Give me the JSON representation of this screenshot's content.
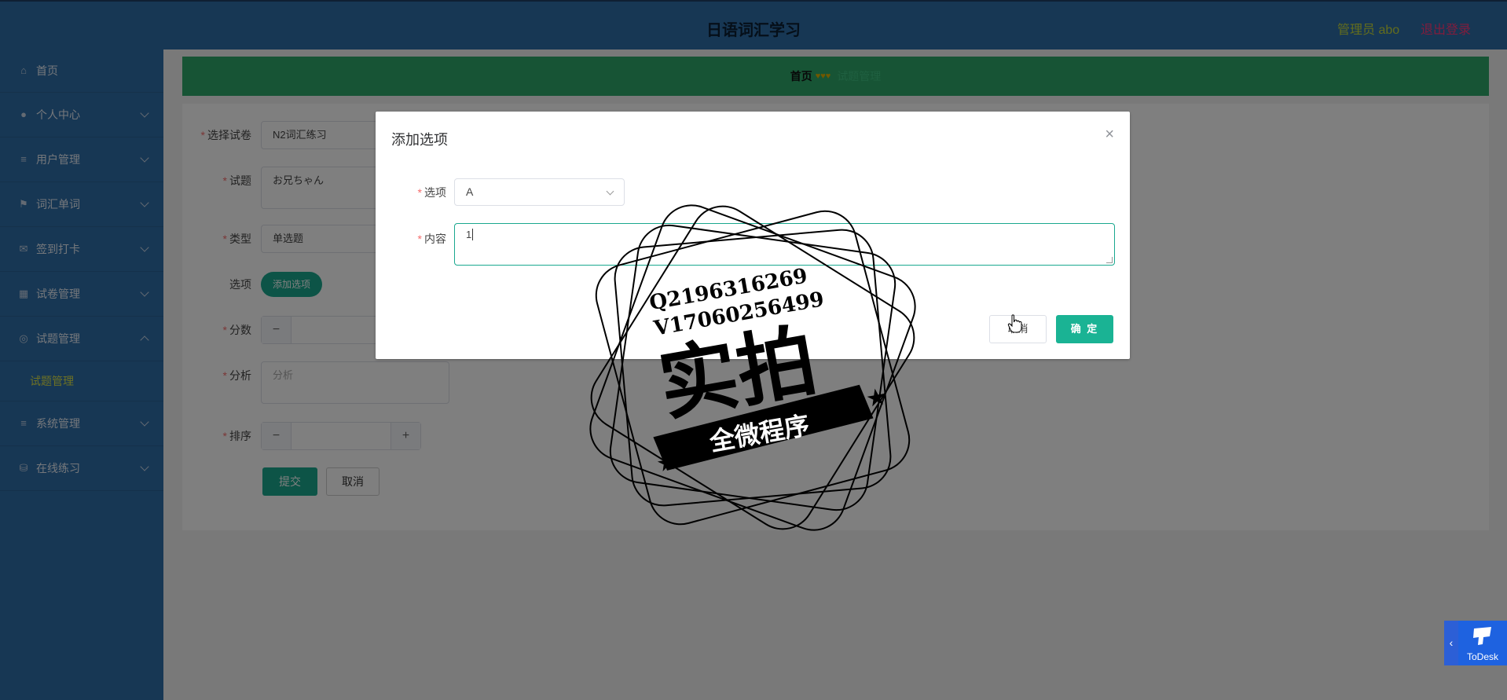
{
  "header": {
    "title": "日语词汇学习",
    "admin_label": "管理员 abo",
    "logout_label": "退出登录"
  },
  "sidebar": {
    "items": [
      {
        "label": "首页",
        "icon": "home-icon"
      },
      {
        "label": "个人中心",
        "icon": "user-icon"
      },
      {
        "label": "用户管理",
        "icon": "list-icon"
      },
      {
        "label": "词汇单词",
        "icon": "flag-icon"
      },
      {
        "label": "签到打卡",
        "icon": "mail-icon"
      },
      {
        "label": "试卷管理",
        "icon": "grid-icon"
      },
      {
        "label": "试题管理",
        "icon": "target-icon"
      }
    ],
    "submenu_label": "试题管理",
    "items_after": [
      {
        "label": "系统管理",
        "icon": "list-icon"
      },
      {
        "label": "在线练习",
        "icon": "stack-icon"
      }
    ]
  },
  "breadcrumb": {
    "home": "首页",
    "separator": "♥♥♥",
    "current": "试题管理"
  },
  "form": {
    "paper_label": "选择试卷",
    "paper_value": "N2词汇练习",
    "question_label": "试题",
    "question_value": "お兄ちゃん",
    "type_label": "类型",
    "type_value": "单选题",
    "options_label": "选项",
    "add_option_button": "添加选项",
    "score_label": "分数",
    "analysis_label": "分析",
    "analysis_placeholder": "分析",
    "order_label": "排序",
    "submit_button": "提交",
    "cancel_button": "取消",
    "stepper_minus": "−",
    "stepper_plus": "+"
  },
  "dialog": {
    "title": "添加选项",
    "close_glyph": "×",
    "option_label": "选项",
    "option_value": "A",
    "content_label": "内容",
    "content_value": "1",
    "cancel_button": "取消",
    "confirm_button": "确 定"
  },
  "watermark": {
    "line1": "Q2196316269",
    "line2": "V17060256499",
    "big": "实拍",
    "ribbon": "全微程序"
  },
  "todesk": {
    "label": "ToDesk",
    "tab_glyph": "‹"
  },
  "colors": {
    "header_bg": "#2f6ea8",
    "breadcrumb_bg": "#2fa86a",
    "accent_green": "#1aa88f",
    "required": "#f56c6c"
  }
}
